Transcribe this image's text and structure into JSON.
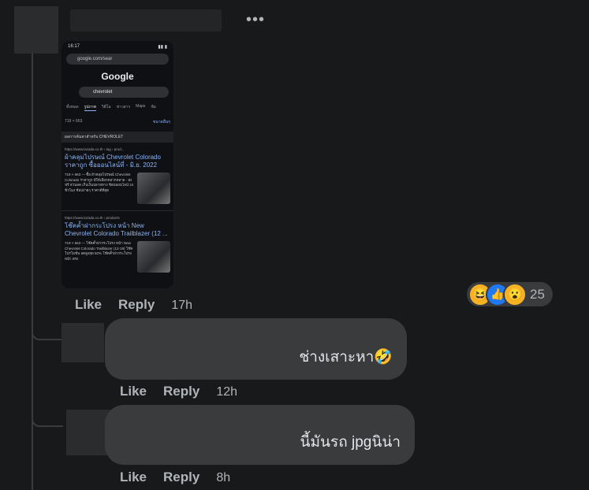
{
  "post_comment": {
    "more_label": "•••",
    "screenshot": {
      "status_time": "16:17",
      "url": "google.com/sear",
      "logo": "Google",
      "query": "chevrolet",
      "tabs": [
        "ทั้งหมด",
        "รูปภาพ",
        "วิดีโอ",
        "ข่าวสาร",
        "Maps",
        "ช้อ"
      ],
      "image_size": "719 × 663",
      "more_link": "ขนาดอื่นๆ",
      "banner": "ผลการค้นหาสำหรับ CHEVROLET",
      "results": [
        {
          "source": "https://www.lazada.co.th › tag › prod...",
          "title": "ผ้าคลุมไปรษณ์ Chevrolet Colorado ราคาถูก ซื้อออนไลน์ที่ - มิ.ย. 2022",
          "body": "719 × 663 — ซื้อ ผ้าคลุมไปรษณ์ Chevrolet Colorado ราคาถูก มีให้เลือกหลากหลาย - ส่งฟรี ส่วนลด เก็บเงินปลายทาง ช้อปออนไลน์ 24 ชั่วโมง ช้อปง่ายๆ ราคาดีที่สุด"
        },
        {
          "source": "https://www.lazada.co.th › products",
          "title": "โช๊คค้ำฝากระโปรง หน้า New Chevrolet Colorado Trailblazer (12 ...",
          "body": "719 × 663 — โช๊คค้ำฝากระโปรง หน้า New Chevrolet Colorado Trailblazer (12-19) โช๊คโปรโมชั่น ลดสูงสุด 50% โช๊คค้ำฝากระโปรงหน้า ตรง"
        }
      ]
    },
    "actions": {
      "like": "Like",
      "reply": "Reply",
      "time": "17h"
    },
    "reactions": {
      "emojis": [
        "haha",
        "like",
        "wow"
      ],
      "count": "25"
    }
  },
  "replies": [
    {
      "text": "ช่างเสาะหา🤣",
      "actions": {
        "like": "Like",
        "reply": "Reply",
        "time": "12h"
      }
    },
    {
      "text": "นี้มันรถ jpgนิน่า",
      "actions": {
        "like": "Like",
        "reply": "Reply",
        "time": "8h"
      }
    }
  ],
  "colors": {
    "background": "#18191a",
    "bubble": "#3a3b3c",
    "link": "#8ab4f8"
  }
}
